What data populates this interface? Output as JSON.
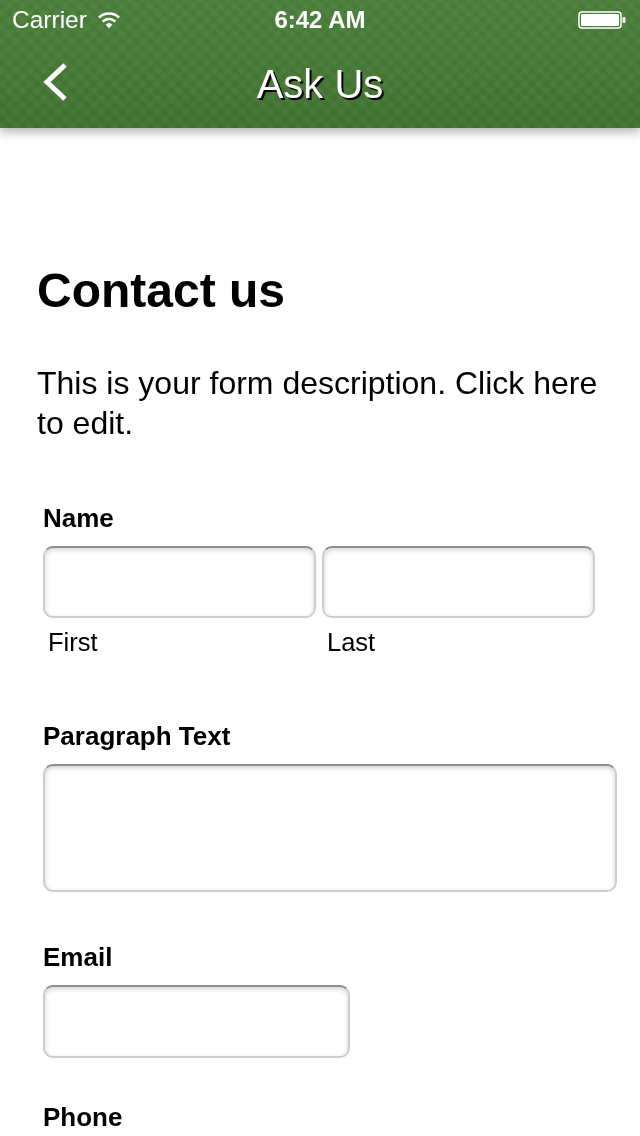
{
  "status_bar": {
    "carrier": "Carrier",
    "time": "6:42 AM"
  },
  "nav_bar": {
    "title": "Ask Us"
  },
  "form": {
    "title": "Contact us",
    "description": "This is your form description. Click here to edit.",
    "fields": [
      {
        "kind": "name",
        "label": "Name",
        "sublabels": [
          "First",
          "Last"
        ]
      },
      {
        "kind": "textarea",
        "label": "Paragraph Text"
      },
      {
        "kind": "text",
        "label": "Email"
      },
      {
        "kind": "label",
        "label": "Phone"
      }
    ]
  }
}
